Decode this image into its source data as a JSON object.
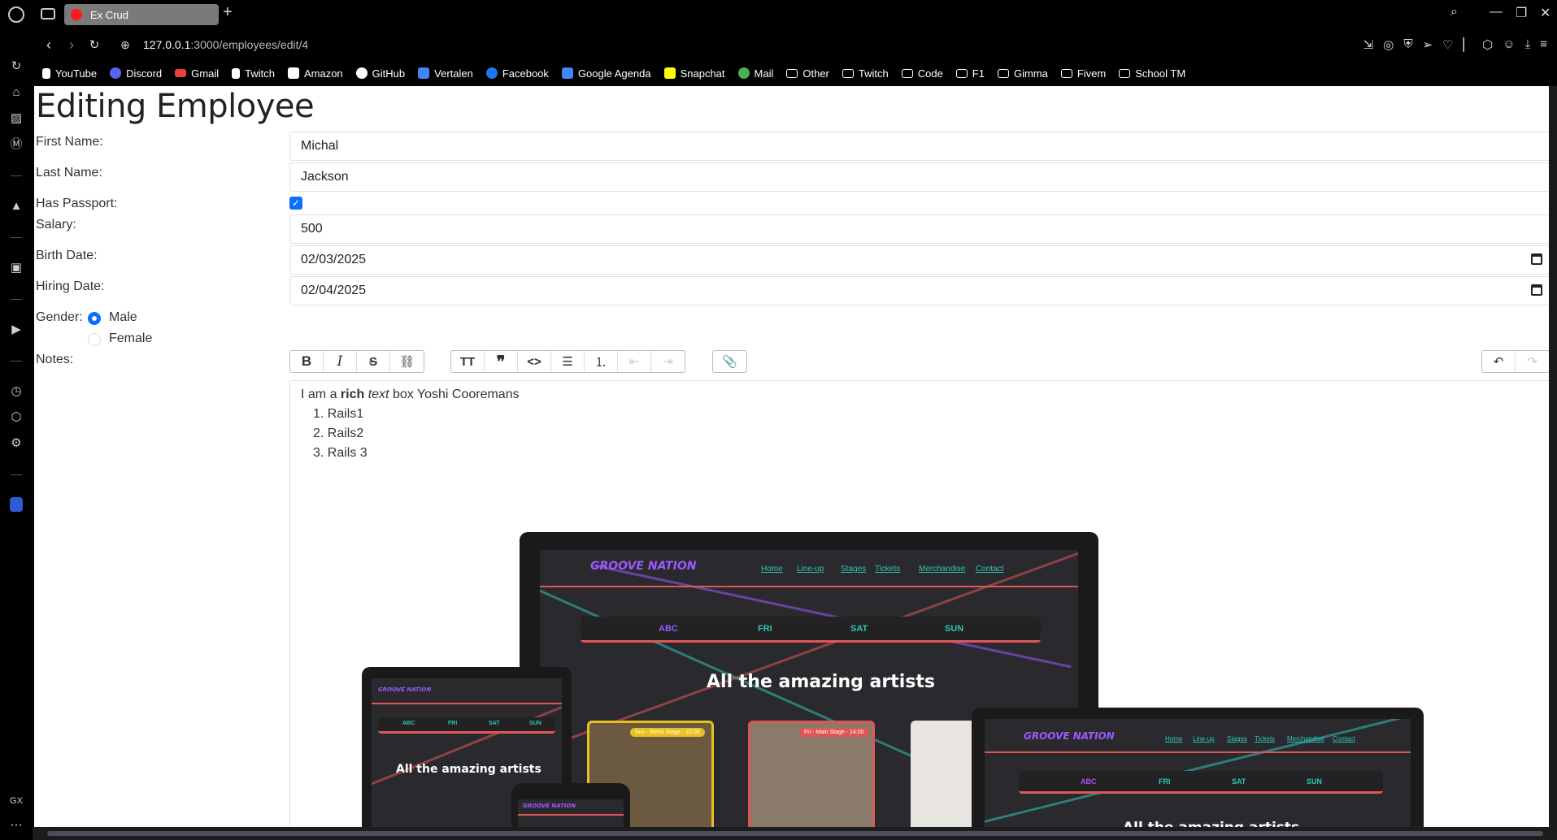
{
  "browser": {
    "tab_title": "Ex Crud",
    "url_host": "127.0.0.1",
    "url_path": ":3000/employees/edit/4",
    "bookmarks": [
      "YouTube",
      "Discord",
      "Gmail",
      "Twitch",
      "Amazon",
      "GitHub",
      "Vertalen",
      "Facebook",
      "Google Agenda",
      "Snapchat",
      "Mail",
      "Other",
      "Twitch",
      "Code",
      "F1",
      "Gimma",
      "Fivem",
      "School TM"
    ],
    "sidebar_footer": "GX"
  },
  "page": {
    "title": "Editing Employee",
    "labels": {
      "first_name": "First Name:",
      "last_name": "Last Name:",
      "has_passport": "Has Passport:",
      "salary": "Salary:",
      "birth_date": "Birth Date:",
      "hiring_date": "Hiring Date:",
      "gender": "Gender:",
      "notes": "Notes:"
    },
    "values": {
      "first_name": "Michal",
      "last_name": "Jackson",
      "has_passport": true,
      "salary": "500",
      "birth_date": "02/03/2025",
      "hiring_date": "02/04/2025"
    },
    "gender_options": [
      "Male",
      "Female"
    ],
    "gender_selected": "Male"
  },
  "editor": {
    "toolbar": [
      "bold-icon",
      "italic-icon",
      "strikethrough-icon",
      "link-icon",
      "heading-icon",
      "quote-icon",
      "code-icon",
      "bullet-list-icon",
      "numbered-list-icon",
      "outdent-icon",
      "indent-icon",
      "attach-icon",
      "undo-icon",
      "redo-icon"
    ],
    "line_pre": "I am a ",
    "line_bold": "rich",
    "line_space": " ",
    "line_italic": "text",
    "line_post": " box Yoshi Cooremans",
    "list": [
      "Rails1",
      "Rails2",
      "Rails 3"
    ]
  },
  "mockup": {
    "logo": "GROOVE NATION",
    "nav": [
      "Home",
      "Line-up",
      "Stages",
      "Tickets",
      "Merchandise",
      "Contact"
    ],
    "days": [
      "ABC",
      "FRI",
      "SAT",
      "SUN"
    ],
    "heading": "All the amazing artists",
    "card_tags": [
      "Sun - Retro Stage - 22:00",
      "Fri - Main Stage - 14:00"
    ]
  },
  "colors": {
    "accent": "#0d6efd",
    "brand_purple": "#9b59ff",
    "brand_teal": "#2ec4b6",
    "brand_red": "#e05656"
  }
}
